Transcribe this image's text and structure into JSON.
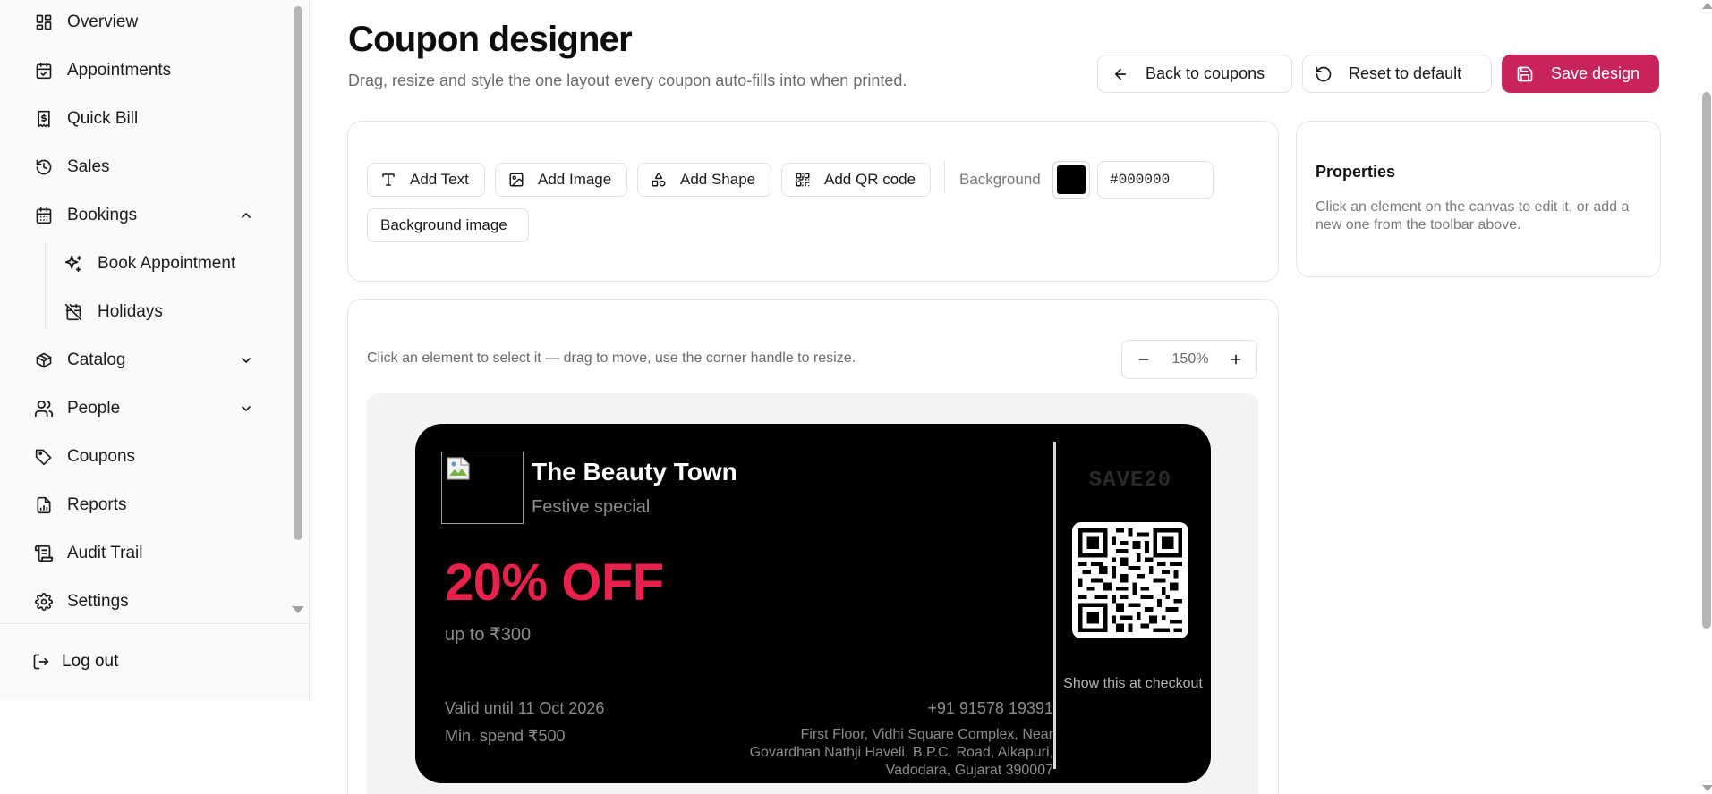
{
  "sidebar": {
    "items": [
      {
        "label": "Overview",
        "icon": "layout-dashboard-icon"
      },
      {
        "label": "Appointments",
        "icon": "calendar-check-icon"
      },
      {
        "label": "Quick Bill",
        "icon": "receipt-icon"
      },
      {
        "label": "Sales",
        "icon": "history-icon"
      },
      {
        "label": "Bookings",
        "icon": "calendar-icon",
        "expanded": true
      },
      {
        "label": "Book Appointment",
        "icon": "sparkles-icon",
        "sub": true
      },
      {
        "label": "Holidays",
        "icon": "calendar-off-icon",
        "sub": true
      },
      {
        "label": "Catalog",
        "icon": "package-icon",
        "expanded": false
      },
      {
        "label": "People",
        "icon": "users-icon",
        "expanded": false
      },
      {
        "label": "Coupons",
        "icon": "tag-icon"
      },
      {
        "label": "Reports",
        "icon": "file-chart-icon"
      },
      {
        "label": "Audit Trail",
        "icon": "scroll-icon"
      },
      {
        "label": "Settings",
        "icon": "gear-icon"
      }
    ],
    "logout_label": "Log out"
  },
  "header": {
    "title": "Coupon designer",
    "subtitle": "Drag, resize and style the one layout every coupon auto-fills into when printed.",
    "back_label": "Back to coupons",
    "reset_label": "Reset to default",
    "save_label": "Save design"
  },
  "toolbar": {
    "add_text": "Add Text",
    "add_image": "Add Image",
    "add_shape": "Add Shape",
    "add_qr": "Add QR code",
    "background_label": "Background",
    "background_color": "#000000",
    "background_hex": "#000000",
    "background_image": "Background image"
  },
  "properties": {
    "title": "Properties",
    "description": "Click an element on the canvas to edit it, or add a new one from the toolbar above."
  },
  "canvas": {
    "hint": "Click an element to select it — drag to move, use the corner handle to resize.",
    "zoom": "150%"
  },
  "coupon": {
    "brand": "The Beauty Town",
    "tagline": "Festive special",
    "offer": "20% OFF",
    "upto": "up to ₹300",
    "valid": "Valid until 11 Oct 2026",
    "min_spend": "Min. spend ₹500",
    "phone": "+91 91578 19391",
    "address_lines": [
      "First Floor, Vidhi Square Complex, Near",
      "Govardhan Nathji Haveli, B.P.C. Road, Alkapuri,",
      "Vadodara, Gujarat 390007"
    ],
    "code": "SAVE20",
    "checkout_note": "Show this at checkout",
    "colors": {
      "background": "#000000",
      "offer": "#e8214c",
      "muted": "#8c8c8c"
    }
  },
  "colors": {
    "accent": "#c8235b"
  }
}
